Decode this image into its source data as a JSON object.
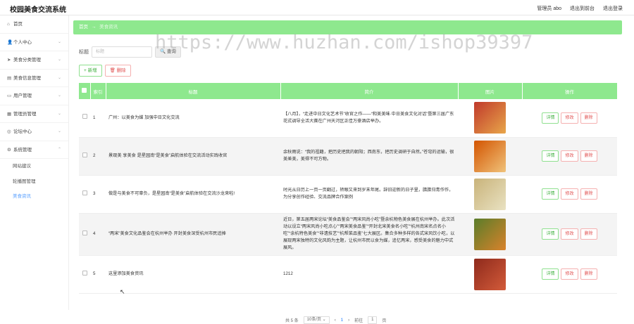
{
  "app": {
    "title": "校园美食交流系统"
  },
  "header": {
    "user": "管理员 abo",
    "back_link": "退出到前台",
    "logout": "退出登录"
  },
  "sidebar": {
    "items": [
      {
        "label": "首页",
        "icon": "home-icon"
      },
      {
        "label": "个人中心",
        "icon": "user-icon"
      },
      {
        "label": "美食分类管理",
        "icon": "send-icon"
      },
      {
        "label": "美食信息管理",
        "icon": "food-icon"
      },
      {
        "label": "用户管理",
        "icon": "users-icon"
      },
      {
        "label": "管理员管理",
        "icon": "admin-icon"
      },
      {
        "label": "论坛中心",
        "icon": "forum-icon"
      },
      {
        "label": "系统管理",
        "icon": "gear-icon"
      }
    ],
    "subitems": [
      {
        "label": "网站建议",
        "active": false
      },
      {
        "label": "轮播图管理",
        "active": false
      },
      {
        "label": "美食资讯",
        "active": true
      }
    ]
  },
  "breadcrumb": {
    "home": "首页",
    "arrow": "→",
    "current": "美食资讯"
  },
  "search": {
    "label": "标题",
    "placeholder": "标题",
    "button": "查询"
  },
  "actions": {
    "add": "+ 新增",
    "delete": "🗑 删除"
  },
  "table": {
    "headers": [
      "",
      "索引",
      "标题",
      "简介",
      "图片",
      "操作"
    ],
    "rows": [
      {
        "index": "1",
        "title": "广州：以美食为媒 加强中日文化交流",
        "intro": "【八月】，“走进中日文化艺术节”收官之作——“和美美味·中日美食文化对话”暨第三届广东花式调导全活大赛在广州天河区正佳万豪酒店举办。",
        "colors": [
          "#c0392b",
          "#e8a64a"
        ]
      },
      {
        "index": "2",
        "title": "景观美 享美食 是星园南“是美食”启航体验在交流活动实践收官",
        "intro": "余秋雨说：“我的祖籍，把历史把我的朝阳；西南东，把历史调研于自然。”苍穹的运输，很美差美，美得不可方物。",
        "colors": [
          "#d35400",
          "#f0c27a"
        ]
      },
      {
        "index": "3",
        "title": "做是与美食不可辜负，是星园南“是美食”启航体验在交流沙龙来啦!",
        "intro": "时光从日历上一页一页翻过，转眼又来到岁末年尾。辞旧迎新的日子里，腊腊归青作作，为分享创作经验、交流品牌合作案例",
        "colors": [
          "#c9b37a",
          "#e9e2c2"
        ]
      },
      {
        "index": "4",
        "title": "“两宋”美食文化品鉴会在杭州举办 开封美食深受杭州市民追捧",
        "intro": "近日，第五届两宋论坛“美食品鉴会”“两宋风尚小吃”暨余杭物色美食展在杭州举办。此次活动以设立“两宋风尚小吃点心”“两宋美食品鉴”“开封北宋美食名小吃”“杭州南宋名点名小吃”“余杭特色美食”“非遗技艺”“杭帮菜品鉴”七大展区。集合多种多样的各式宋风饮小吃，以展现两宋独特的文化风韵为主题，让杭州市民以食为媒，追忆两宋，感受美食的魅力中式展风。",
        "colors": [
          "#5a7d2a",
          "#d9822b"
        ]
      },
      {
        "index": "5",
        "title": "这里添加美食资讯",
        "intro": "1212",
        "colors": [
          "#8e2a1c",
          "#d35b3a"
        ]
      }
    ],
    "buttons": {
      "detail": "详情",
      "modify": "修改",
      "delete": "删除"
    }
  },
  "pagination": {
    "total": "共 5 条",
    "per_page": "10条/页",
    "prev": "‹",
    "page": "1",
    "next": "›",
    "goto_label": "前往",
    "goto_value": "1",
    "goto_suffix": "页"
  },
  "watermark": "https://www.huzhan.com/ishop39397"
}
